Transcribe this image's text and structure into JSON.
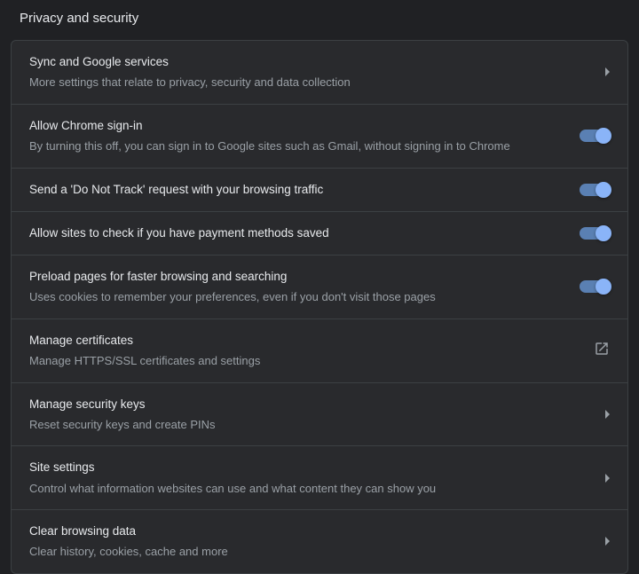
{
  "section_title": "Privacy and security",
  "rows": [
    {
      "title": "Sync and Google services",
      "desc": "More settings that relate to privacy, security and data collection",
      "action": "chevron"
    },
    {
      "title": "Allow Chrome sign-in",
      "desc": "By turning this off, you can sign in to Google sites such as Gmail, without signing in to Chrome",
      "action": "toggle",
      "toggle_on": true
    },
    {
      "title": "Send a 'Do Not Track' request with your browsing traffic",
      "desc": "",
      "action": "toggle",
      "toggle_on": true
    },
    {
      "title": "Allow sites to check if you have payment methods saved",
      "desc": "",
      "action": "toggle",
      "toggle_on": true
    },
    {
      "title": "Preload pages for faster browsing and searching",
      "desc": "Uses cookies to remember your preferences, even if you don't visit those pages",
      "action": "toggle",
      "toggle_on": true
    },
    {
      "title": "Manage certificates",
      "desc": "Manage HTTPS/SSL certificates and settings",
      "action": "external"
    },
    {
      "title": "Manage security keys",
      "desc": "Reset security keys and create PINs",
      "action": "chevron"
    },
    {
      "title": "Site settings",
      "desc": "Control what information websites can use and what content they can show you",
      "action": "chevron"
    },
    {
      "title": "Clear browsing data",
      "desc": "Clear history, cookies, cache and more",
      "action": "chevron"
    }
  ]
}
